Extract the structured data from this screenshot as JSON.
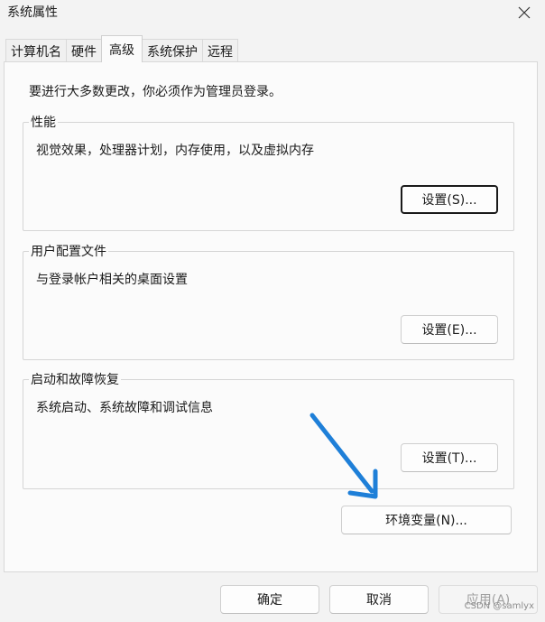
{
  "window": {
    "title": "系统属性"
  },
  "tabs": [
    {
      "label": "计算机名",
      "active": false
    },
    {
      "label": "硬件",
      "active": false
    },
    {
      "label": "高级",
      "active": true
    },
    {
      "label": "系统保护",
      "active": false
    },
    {
      "label": "远程",
      "active": false
    }
  ],
  "panel": {
    "admin_note": "要进行大多数更改，你必须作为管理员登录。",
    "performance": {
      "label": "性能",
      "description": "视觉效果，处理器计划，内存使用，以及虚拟内存",
      "button": "设置(S)..."
    },
    "user_profiles": {
      "label": "用户配置文件",
      "description": "与登录帐户相关的桌面设置",
      "button": "设置(E)..."
    },
    "startup_recovery": {
      "label": "启动和故障恢复",
      "description": "系统启动、系统故障和调试信息",
      "button": "设置(T)..."
    },
    "env_vars_button": "环境变量(N)..."
  },
  "footer": {
    "ok": "确定",
    "cancel": "取消",
    "apply": "应用(A)"
  },
  "watermark": "CSDN @samlyx",
  "colors": {
    "arrow": "#1e7fd8",
    "panel_bg": "#fbfbfb",
    "window_bg": "#f3f3f3"
  },
  "icons": {
    "close": "close-icon",
    "annotation": "arrow-annotation-icon"
  }
}
